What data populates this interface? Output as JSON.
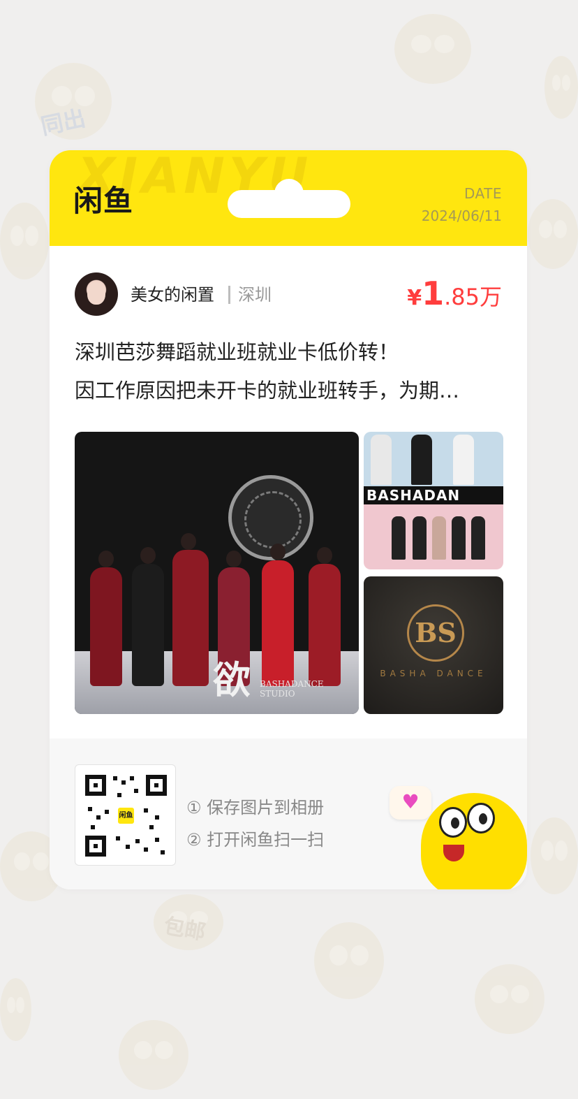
{
  "header": {
    "logo_text": "闲鱼",
    "watermark": "XIANYU",
    "date_label": "DATE",
    "date_value": "2024/06/11"
  },
  "seller": {
    "name": "美女的闲置",
    "city": "深圳"
  },
  "price": {
    "currency": "¥",
    "integer": "1",
    "decimal": ".85",
    "unit": "万"
  },
  "description": {
    "line1": "深圳芭莎舞蹈就业班就业卡低价转！",
    "line2": "因工作原因把未开卡的就业班转手，为期…"
  },
  "images": {
    "main_caption": "欲",
    "main_caption_sub": "BASHADANCE STUDIO",
    "side1_banner": "BASHADAN",
    "side2_emblem": "BS",
    "side2_brand": "BASHA DANCE"
  },
  "footer": {
    "qr_center_label": "闲鱼",
    "step1": "① 保存图片到相册",
    "step2": "② 打开闲鱼扫一扫",
    "bubble_icon": "♥"
  },
  "background": {
    "labels": [
      "同出",
      "包邮"
    ]
  },
  "colors": {
    "brand_yellow": "#ffe60f",
    "price_red": "#ff3d3d",
    "page_bg": "#f0efee"
  }
}
